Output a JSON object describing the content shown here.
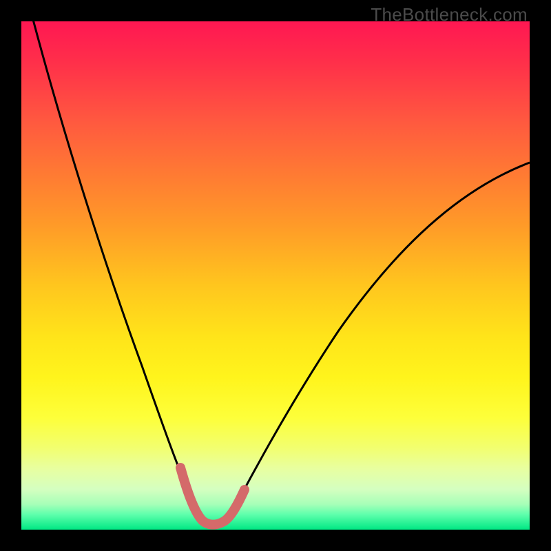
{
  "watermark": "TheBottleneck.com",
  "chart_data": {
    "type": "line",
    "title": "",
    "xlabel": "",
    "ylabel": "",
    "xlim": [
      0,
      100
    ],
    "ylim": [
      0,
      100
    ],
    "grid": false,
    "annotations": [],
    "description": "Bottleneck-style V curve on a vertical red→green gradient. One black curve descends steeply from top-left, reaches ~0 around x≈35, then rises toward ~72 at the right edge. A thick salmon segment highlights the trough (x≈30–40).",
    "series": [
      {
        "name": "curve",
        "color": "#000000",
        "x": [
          2,
          5,
          10,
          15,
          20,
          25,
          30,
          33,
          36,
          40,
          45,
          50,
          55,
          60,
          65,
          70,
          75,
          80,
          85,
          90,
          95,
          100
        ],
        "y": [
          100,
          92,
          77,
          62,
          47,
          32,
          14,
          5,
          2,
          5,
          15,
          25,
          34,
          41,
          48,
          54,
          59,
          63,
          66,
          69,
          71,
          72
        ]
      },
      {
        "name": "highlight",
        "color": "#d46a6a",
        "x": [
          30,
          32,
          34,
          36,
          38,
          40
        ],
        "y": [
          13,
          5,
          1,
          1,
          3,
          8
        ]
      }
    ]
  }
}
